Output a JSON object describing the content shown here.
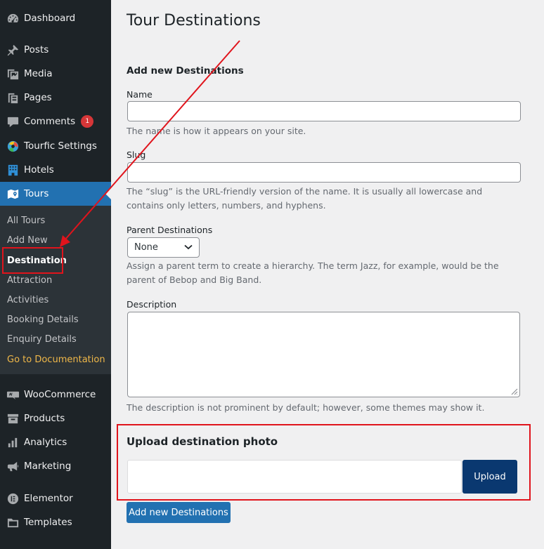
{
  "sidebar": {
    "items": [
      {
        "label": "Dashboard",
        "icon": "dashboard-icon"
      },
      {
        "label": "Posts",
        "icon": "pin-icon"
      },
      {
        "label": "Media",
        "icon": "media-icon"
      },
      {
        "label": "Pages",
        "icon": "pages-icon"
      },
      {
        "label": "Comments",
        "icon": "comment-icon",
        "badge": "1"
      },
      {
        "label": "Tourfic Settings",
        "icon": "tourfic-logo-icon"
      },
      {
        "label": "Hotels",
        "icon": "building-icon"
      },
      {
        "label": "Tours",
        "icon": "map-icon"
      },
      {
        "label": "WooCommerce",
        "icon": "woo-icon"
      },
      {
        "label": "Products",
        "icon": "archive-icon"
      },
      {
        "label": "Analytics",
        "icon": "bar-chart-icon"
      },
      {
        "label": "Marketing",
        "icon": "megaphone-icon"
      },
      {
        "label": "Elementor",
        "icon": "elementor-icon"
      },
      {
        "label": "Templates",
        "icon": "folder-icon"
      }
    ],
    "submenu": [
      {
        "label": "All Tours"
      },
      {
        "label": "Add New"
      },
      {
        "label": "Destination"
      },
      {
        "label": "Attraction"
      },
      {
        "label": "Activities"
      },
      {
        "label": "Booking Details"
      },
      {
        "label": "Enquiry Details"
      },
      {
        "label": "Go to Documentation"
      }
    ]
  },
  "main": {
    "title": "Tour Destinations",
    "section_title": "Add new Destinations",
    "name": {
      "label": "Name",
      "value": "",
      "description": "The name is how it appears on your site."
    },
    "slug": {
      "label": "Slug",
      "value": "",
      "description": "The “slug” is the URL-friendly version of the name. It is usually all lowercase and contains only letters, numbers, and hyphens."
    },
    "parent": {
      "label": "Parent Destinations",
      "selected": "None",
      "description": "Assign a parent term to create a hierarchy. The term Jazz, for example, would be the parent of Bebop and Big Band."
    },
    "description": {
      "label": "Description",
      "value": "",
      "description": "The description is not prominent by default; however, some themes may show it."
    },
    "upload": {
      "title": "Upload destination photo",
      "value": "",
      "button": "Upload"
    },
    "submit_label": "Add new Destinations"
  },
  "colors": {
    "sidebar_bg": "#1d2327",
    "submenu_bg": "#2c3338",
    "accent": "#2271b1",
    "upload_button": "#0a3870",
    "annotation_red": "#e0141c",
    "documentation_link": "#f0b849"
  }
}
